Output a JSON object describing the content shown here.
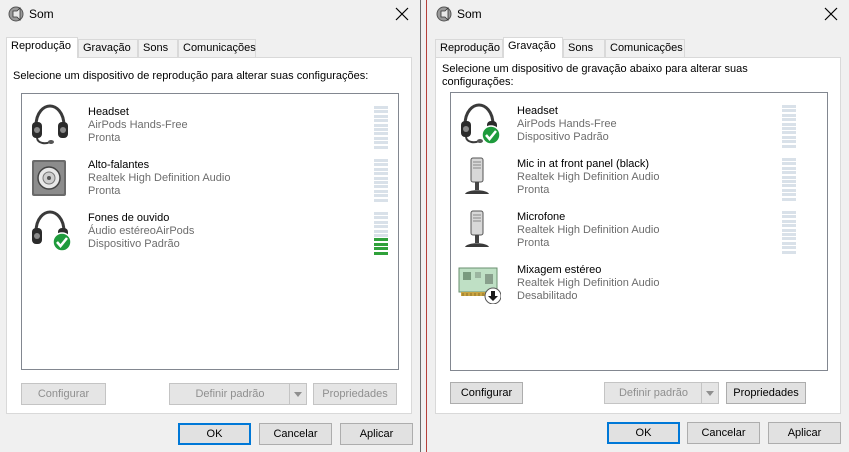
{
  "windows": {
    "playback": {
      "title": "Som",
      "tabs": [
        {
          "label": "Reprodução",
          "active": true
        },
        {
          "label": "Gravação",
          "active": false
        },
        {
          "label": "Sons",
          "active": false
        },
        {
          "label": "Comunicações",
          "active": false
        }
      ],
      "instruction": "Selecione um dispositivo de reprodução para alterar suas configurações:",
      "devices": [
        {
          "name": "Headset",
          "description": "AirPods Hands-Free",
          "status": "Pronta",
          "icon": "headset-icon",
          "is_default": false,
          "level": 0
        },
        {
          "name": "Alto-falantes",
          "description": "Realtek High Definition Audio",
          "status": "Pronta",
          "icon": "speaker-icon",
          "is_default": false,
          "level": 0
        },
        {
          "name": "Fones de ouvido",
          "description": "Áudio estéreoAirPods",
          "status": "Dispositivo Padrão",
          "icon": "headphones-icon",
          "is_default": true,
          "level": 0.35
        }
      ],
      "buttons": {
        "configure": "Configurar",
        "set_default": "Definir padrão",
        "properties": "Propriedades",
        "ok": "OK",
        "cancel": "Cancelar",
        "apply": "Aplicar"
      }
    },
    "recording": {
      "title": "Som",
      "tabs": [
        {
          "label": "Reprodução",
          "active": false
        },
        {
          "label": "Gravação",
          "active": true
        },
        {
          "label": "Sons",
          "active": false
        },
        {
          "label": "Comunicações",
          "active": false
        }
      ],
      "instruction_line1": "Selecione um dispositivo de gravação abaixo para alterar suas",
      "instruction_line2": "configurações:",
      "devices": [
        {
          "name": "Headset",
          "description": "AirPods Hands-Free",
          "status": "Dispositivo Padrão",
          "icon": "headset-icon",
          "is_default": true,
          "level": 0
        },
        {
          "name": "Mic in at front panel (black)",
          "description": "Realtek High Definition Audio",
          "status": "Pronta",
          "icon": "microphone-icon",
          "is_default": false,
          "level": 0
        },
        {
          "name": "Microfone",
          "description": "Realtek High Definition Audio",
          "status": "Pronta",
          "icon": "microphone-icon",
          "is_default": false,
          "level": 0
        },
        {
          "name": "Mixagem estéreo",
          "description": "Realtek High Definition Audio",
          "status": "Desabilitado",
          "icon": "sound-card-icon",
          "is_default": false,
          "level": null
        }
      ],
      "buttons": {
        "configure": "Configurar",
        "set_default": "Definir padrão",
        "properties": "Propriedades",
        "ok": "OK",
        "cancel": "Cancelar",
        "apply": "Aplicar"
      }
    }
  },
  "colors": {
    "accent": "#0078d7",
    "default_check": "#1e9b3c",
    "meter_lit": "#2fa13a",
    "meter_unlit": "#d9e1e9",
    "secondary_text": "#6d6d6d"
  }
}
